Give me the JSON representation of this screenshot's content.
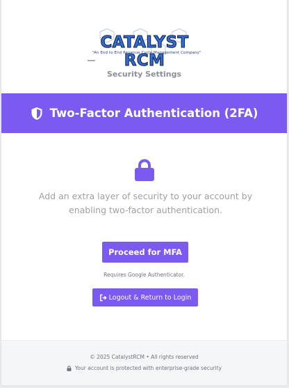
{
  "brand": {
    "name": "CATALYST RCM",
    "tagline": "\"An End to End Revenue Cycle Management Company\""
  },
  "page": {
    "subtitle": "Security Settings"
  },
  "banner": {
    "icon": "shield-icon",
    "title": "Two-Factor Authentication (2FA)"
  },
  "content": {
    "icon": "lock-icon",
    "description": "Add an extra layer of security to your account by enabling two-factor authentication.",
    "proceed_label": "Proceed for MFA",
    "requirement_note": "Requires Google Authenticator.",
    "logout_icon": "sign-out-icon",
    "logout_label": "Logout & Return to Login"
  },
  "footer": {
    "copyright": "© 2025 CatalystRCM • All rights reserved",
    "security_icon": "lock-icon",
    "security_note": "Your account is protected with enterprise-grade security"
  },
  "colors": {
    "accent": "#7b5af2",
    "muted_text": "#9ba0a8",
    "footer_bg": "#f4f6f8"
  }
}
